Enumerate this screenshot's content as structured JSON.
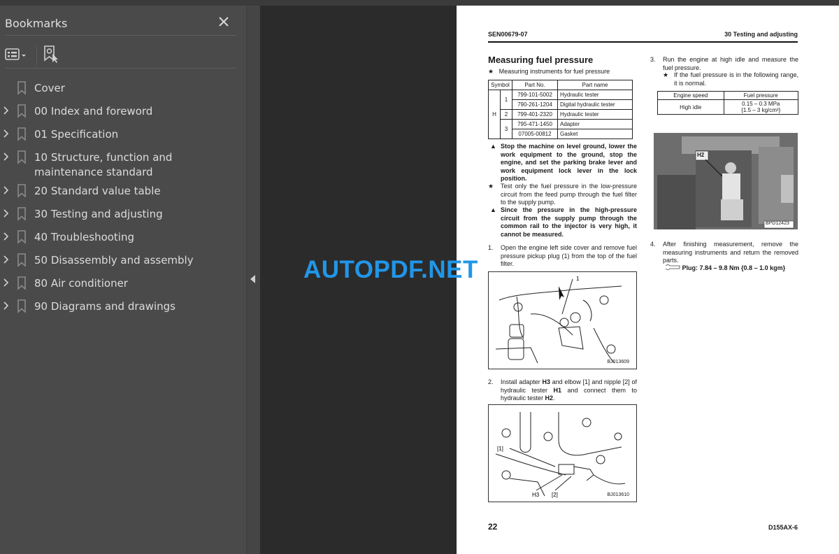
{
  "sidebar": {
    "title": "Bookmarks",
    "close_icon": "close-icon",
    "toolbar": {
      "options_icon": "list-options-icon",
      "find_icon": "bookmark-find-icon"
    },
    "items": [
      {
        "label": "Cover",
        "expandable": false
      },
      {
        "label": "00 Index and foreword",
        "expandable": true
      },
      {
        "label": "01 Specification",
        "expandable": true
      },
      {
        "label": "10 Structure, function and maintenance standard",
        "expandable": true
      },
      {
        "label": "20 Standard value table",
        "expandable": true
      },
      {
        "label": "30 Testing and adjusting",
        "expandable": true
      },
      {
        "label": "40 Troubleshooting",
        "expandable": true
      },
      {
        "label": "50 Disassembly and assembly",
        "expandable": true
      },
      {
        "label": "80 Air conditioner",
        "expandable": true
      },
      {
        "label": "90 Diagrams and drawings",
        "expandable": true
      }
    ]
  },
  "watermark": "AUTOPDF.NET",
  "page": {
    "header_left": "SEN00679-07",
    "header_right": "30 Testing and adjusting",
    "title": "Measuring fuel pressure",
    "instruments_note": "Measuring instruments for fuel pressure",
    "parts_table": {
      "headers": [
        "Symbol",
        "Part No.",
        "Part name"
      ],
      "symbol": "H",
      "rows": [
        {
          "sub": "1",
          "part_no": "799-101-5002",
          "part_name": "Hydraulic tester"
        },
        {
          "sub": "",
          "part_no": "790-261-1204",
          "part_name": "Digital hydraulic tester"
        },
        {
          "sub": "2",
          "part_no": "799-401-2320",
          "part_name": "Hydraulic tester"
        },
        {
          "sub": "3",
          "part_no": "795-471-1450",
          "part_name": "Adapter"
        },
        {
          "sub": "",
          "part_no": "07005-00812",
          "part_name": "Gasket"
        }
      ]
    },
    "warning1": "Stop the machine on level ground, lower the work equipment to the ground, stop the engine, and set the parking brake lever and work equipment lock lever in the lock position.",
    "note1": "Test only the fuel pressure in the low-pressure circuit from the feed pump through the fuel filter to the supply pump.",
    "warning2": "Since the pressure in the high-pressure circuit from the supply pump through the common rail to the injector is very high, it cannot be measured.",
    "step1_num": "1.",
    "step1": "Open the engine left side cover and remove fuel pressure pickup plug (1) from the top of the fuel filter.",
    "fig1_code": "BJ013609",
    "fig1_label": "1",
    "step2_num": "2.",
    "step2_a": "Install adapter ",
    "step2_b": "H3",
    "step2_c": " and elbow [1] and nipple [2] of hydraulic tester ",
    "step2_d": "H1",
    "step2_e": " and connect them to hydraulic tester ",
    "step2_f": "H2",
    "step2_g": ".",
    "fig2_code": "BJ013610",
    "fig2_labels": {
      "l1": "[1]",
      "h3": "H3",
      "l2": "[2]"
    },
    "step3_num": "3.",
    "step3": "Run the engine at high idle and measure the fuel pressure.",
    "step3_note": "If the fuel pressure is in the following range, it is normal.",
    "fp_table": {
      "headers": [
        "Engine speed",
        "Fuel pressure"
      ],
      "row": {
        "speed": "High idle",
        "pressure_1": "0.15 – 0.3 MPa",
        "pressure_2": "{1.5 – 3 kg/cm²}"
      }
    },
    "photo_label": "H2",
    "photo_code": "BPD12423",
    "step4_num": "4.",
    "step4": "After finishing measurement, remove the measuring instruments and return the removed parts.",
    "torque": "Plug: 7.84 – 9.8 Nm {0.8 – 1.0 kgm}",
    "page_number": "22",
    "model": "D155AX-6"
  }
}
